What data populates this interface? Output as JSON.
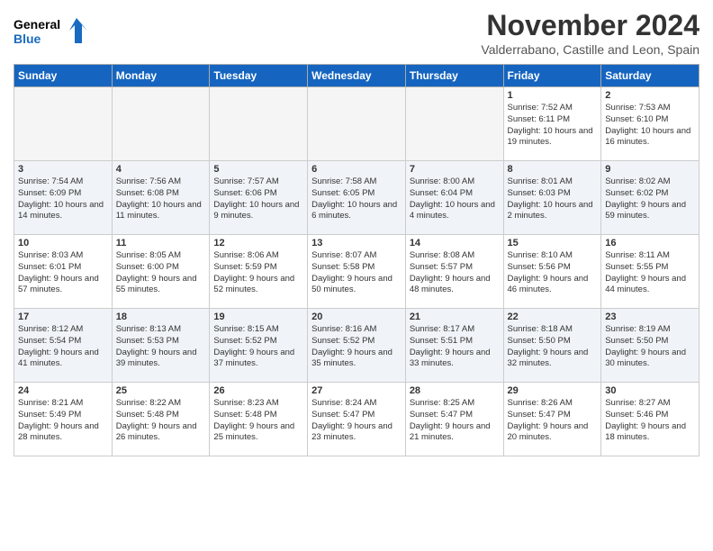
{
  "logo": {
    "line1": "General",
    "line2": "Blue"
  },
  "header": {
    "month": "November 2024",
    "location": "Valderrabano, Castille and Leon, Spain"
  },
  "weekdays": [
    "Sunday",
    "Monday",
    "Tuesday",
    "Wednesday",
    "Thursday",
    "Friday",
    "Saturday"
  ],
  "weeks": [
    [
      {
        "day": "",
        "info": ""
      },
      {
        "day": "",
        "info": ""
      },
      {
        "day": "",
        "info": ""
      },
      {
        "day": "",
        "info": ""
      },
      {
        "day": "",
        "info": ""
      },
      {
        "day": "1",
        "info": "Sunrise: 7:52 AM\nSunset: 6:11 PM\nDaylight: 10 hours and 19 minutes."
      },
      {
        "day": "2",
        "info": "Sunrise: 7:53 AM\nSunset: 6:10 PM\nDaylight: 10 hours and 16 minutes."
      }
    ],
    [
      {
        "day": "3",
        "info": "Sunrise: 7:54 AM\nSunset: 6:09 PM\nDaylight: 10 hours and 14 minutes."
      },
      {
        "day": "4",
        "info": "Sunrise: 7:56 AM\nSunset: 6:08 PM\nDaylight: 10 hours and 11 minutes."
      },
      {
        "day": "5",
        "info": "Sunrise: 7:57 AM\nSunset: 6:06 PM\nDaylight: 10 hours and 9 minutes."
      },
      {
        "day": "6",
        "info": "Sunrise: 7:58 AM\nSunset: 6:05 PM\nDaylight: 10 hours and 6 minutes."
      },
      {
        "day": "7",
        "info": "Sunrise: 8:00 AM\nSunset: 6:04 PM\nDaylight: 10 hours and 4 minutes."
      },
      {
        "day": "8",
        "info": "Sunrise: 8:01 AM\nSunset: 6:03 PM\nDaylight: 10 hours and 2 minutes."
      },
      {
        "day": "9",
        "info": "Sunrise: 8:02 AM\nSunset: 6:02 PM\nDaylight: 9 hours and 59 minutes."
      }
    ],
    [
      {
        "day": "10",
        "info": "Sunrise: 8:03 AM\nSunset: 6:01 PM\nDaylight: 9 hours and 57 minutes."
      },
      {
        "day": "11",
        "info": "Sunrise: 8:05 AM\nSunset: 6:00 PM\nDaylight: 9 hours and 55 minutes."
      },
      {
        "day": "12",
        "info": "Sunrise: 8:06 AM\nSunset: 5:59 PM\nDaylight: 9 hours and 52 minutes."
      },
      {
        "day": "13",
        "info": "Sunrise: 8:07 AM\nSunset: 5:58 PM\nDaylight: 9 hours and 50 minutes."
      },
      {
        "day": "14",
        "info": "Sunrise: 8:08 AM\nSunset: 5:57 PM\nDaylight: 9 hours and 48 minutes."
      },
      {
        "day": "15",
        "info": "Sunrise: 8:10 AM\nSunset: 5:56 PM\nDaylight: 9 hours and 46 minutes."
      },
      {
        "day": "16",
        "info": "Sunrise: 8:11 AM\nSunset: 5:55 PM\nDaylight: 9 hours and 44 minutes."
      }
    ],
    [
      {
        "day": "17",
        "info": "Sunrise: 8:12 AM\nSunset: 5:54 PM\nDaylight: 9 hours and 41 minutes."
      },
      {
        "day": "18",
        "info": "Sunrise: 8:13 AM\nSunset: 5:53 PM\nDaylight: 9 hours and 39 minutes."
      },
      {
        "day": "19",
        "info": "Sunrise: 8:15 AM\nSunset: 5:52 PM\nDaylight: 9 hours and 37 minutes."
      },
      {
        "day": "20",
        "info": "Sunrise: 8:16 AM\nSunset: 5:52 PM\nDaylight: 9 hours and 35 minutes."
      },
      {
        "day": "21",
        "info": "Sunrise: 8:17 AM\nSunset: 5:51 PM\nDaylight: 9 hours and 33 minutes."
      },
      {
        "day": "22",
        "info": "Sunrise: 8:18 AM\nSunset: 5:50 PM\nDaylight: 9 hours and 32 minutes."
      },
      {
        "day": "23",
        "info": "Sunrise: 8:19 AM\nSunset: 5:50 PM\nDaylight: 9 hours and 30 minutes."
      }
    ],
    [
      {
        "day": "24",
        "info": "Sunrise: 8:21 AM\nSunset: 5:49 PM\nDaylight: 9 hours and 28 minutes."
      },
      {
        "day": "25",
        "info": "Sunrise: 8:22 AM\nSunset: 5:48 PM\nDaylight: 9 hours and 26 minutes."
      },
      {
        "day": "26",
        "info": "Sunrise: 8:23 AM\nSunset: 5:48 PM\nDaylight: 9 hours and 25 minutes."
      },
      {
        "day": "27",
        "info": "Sunrise: 8:24 AM\nSunset: 5:47 PM\nDaylight: 9 hours and 23 minutes."
      },
      {
        "day": "28",
        "info": "Sunrise: 8:25 AM\nSunset: 5:47 PM\nDaylight: 9 hours and 21 minutes."
      },
      {
        "day": "29",
        "info": "Sunrise: 8:26 AM\nSunset: 5:47 PM\nDaylight: 9 hours and 20 minutes."
      },
      {
        "day": "30",
        "info": "Sunrise: 8:27 AM\nSunset: 5:46 PM\nDaylight: 9 hours and 18 minutes."
      }
    ]
  ]
}
